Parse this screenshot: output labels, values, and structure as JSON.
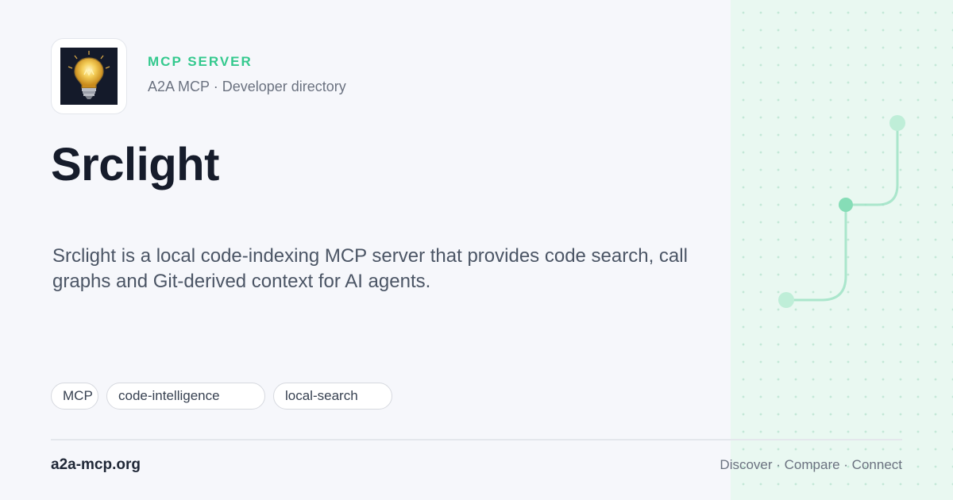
{
  "header": {
    "kicker": "MCP SERVER",
    "subline": "A2A MCP · Developer directory",
    "logo_icon": "lightbulb-icon"
  },
  "main": {
    "title": "Srclight",
    "description": "Srclight is a local code-indexing MCP server that provides code search, call graphs and Git-derived context for AI agents."
  },
  "tags": [
    "MCP",
    "code-intelligence",
    "local-search"
  ],
  "footer": {
    "site": "a2a-mcp.org",
    "links": "Discover · Compare · Connect"
  },
  "colors": {
    "accent": "#34c98e",
    "title": "#161c2b",
    "body_text": "#4b5565",
    "muted": "#6b7280",
    "background": "#f6f7fb",
    "panel": "#e9f8f1"
  }
}
